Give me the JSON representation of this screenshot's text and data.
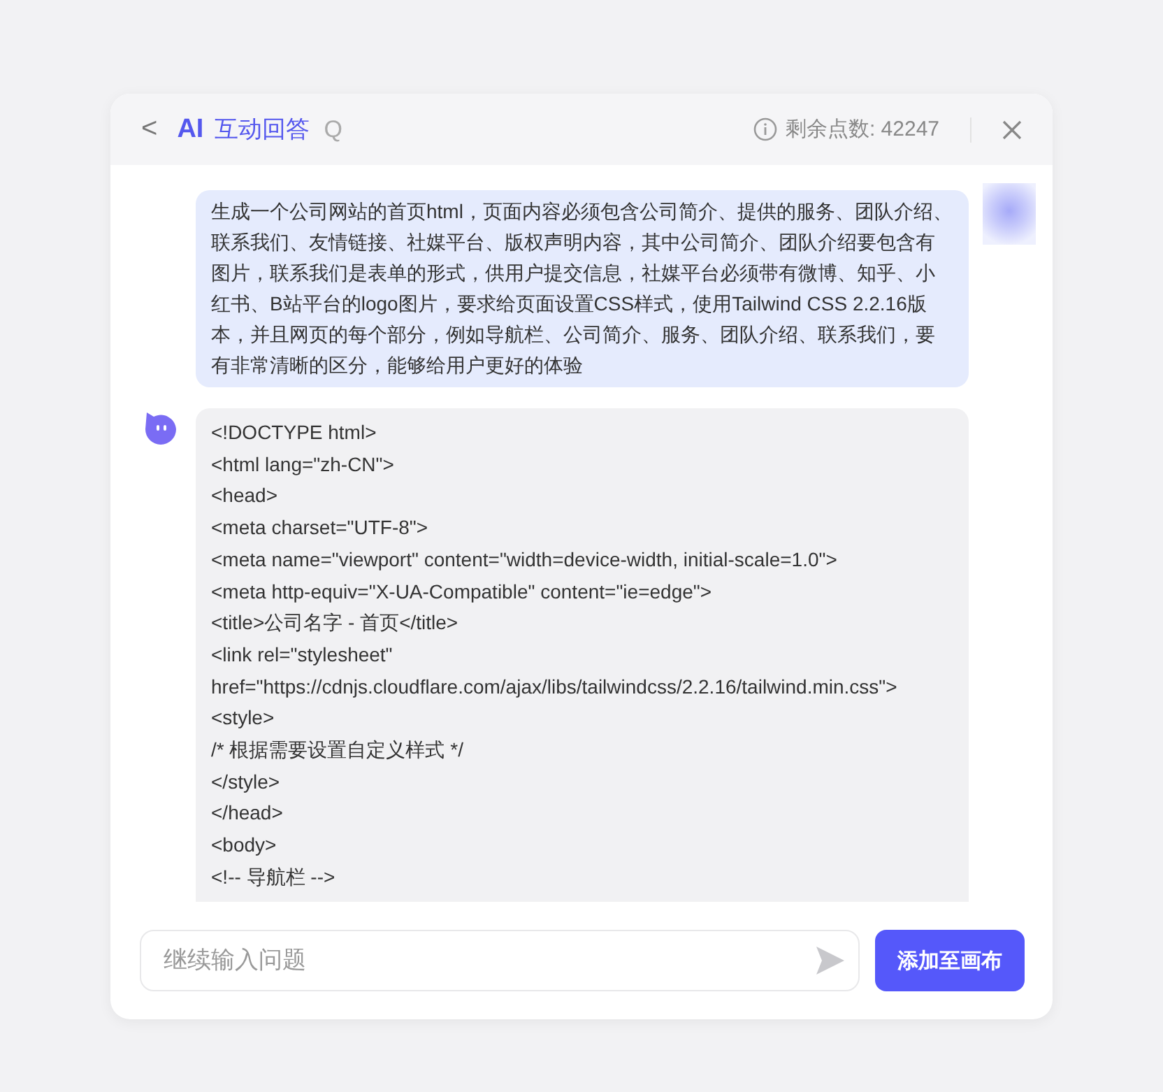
{
  "header": {
    "back": "<",
    "logo": "AI",
    "title": "互动回答",
    "title_suffix": "Q",
    "credits": "剩余点数: 42247"
  },
  "messages": [
    {
      "kind": "user",
      "text": "生成一个公司网站的首页html，页面内容必须包含公司简介、提供的服务、团队介绍、联系我们、友情链接、社媒平台、版权声明内容，其中公司简介、团队介绍要包含有图片，联系我们是表单的形式，供用户提交信息，社媒平台必须带有微博、知乎、小红书、B站平台的logo图片，要求给页面设置CSS样式，使用Tailwind CSS 2.2.16版本，并且网页的每个部分，例如导航栏、公司简介、服务、团队介绍、联系我们，要有非常清晰的区分，能够给用户更好的体验"
    },
    {
      "kind": "bot",
      "lines": [
        "<!DOCTYPE html>",
        "<html lang=\"zh-CN\">",
        "<head>",
        "<meta charset=\"UTF-8\">",
        "<meta name=\"viewport\" content=\"width=device-width, initial-scale=1.0\">",
        "<meta http-equiv=\"X-UA-Compatible\" content=\"ie=edge\">",
        "<title>公司名字 - 首页</title>",
        "<link rel=\"stylesheet\"",
        "href=\"https://cdnjs.cloudflare.com/ajax/libs/tailwindcss/2.2.16/tailwind.min.css\">",
        "<style>",
        "/* 根据需要设置自定义样式 */",
        "</style>",
        "</head>",
        "<body>",
        "<!-- 导航栏 -->"
      ]
    }
  ],
  "input": {
    "placeholder": "继续输入问题"
  },
  "button": "添加至画布"
}
